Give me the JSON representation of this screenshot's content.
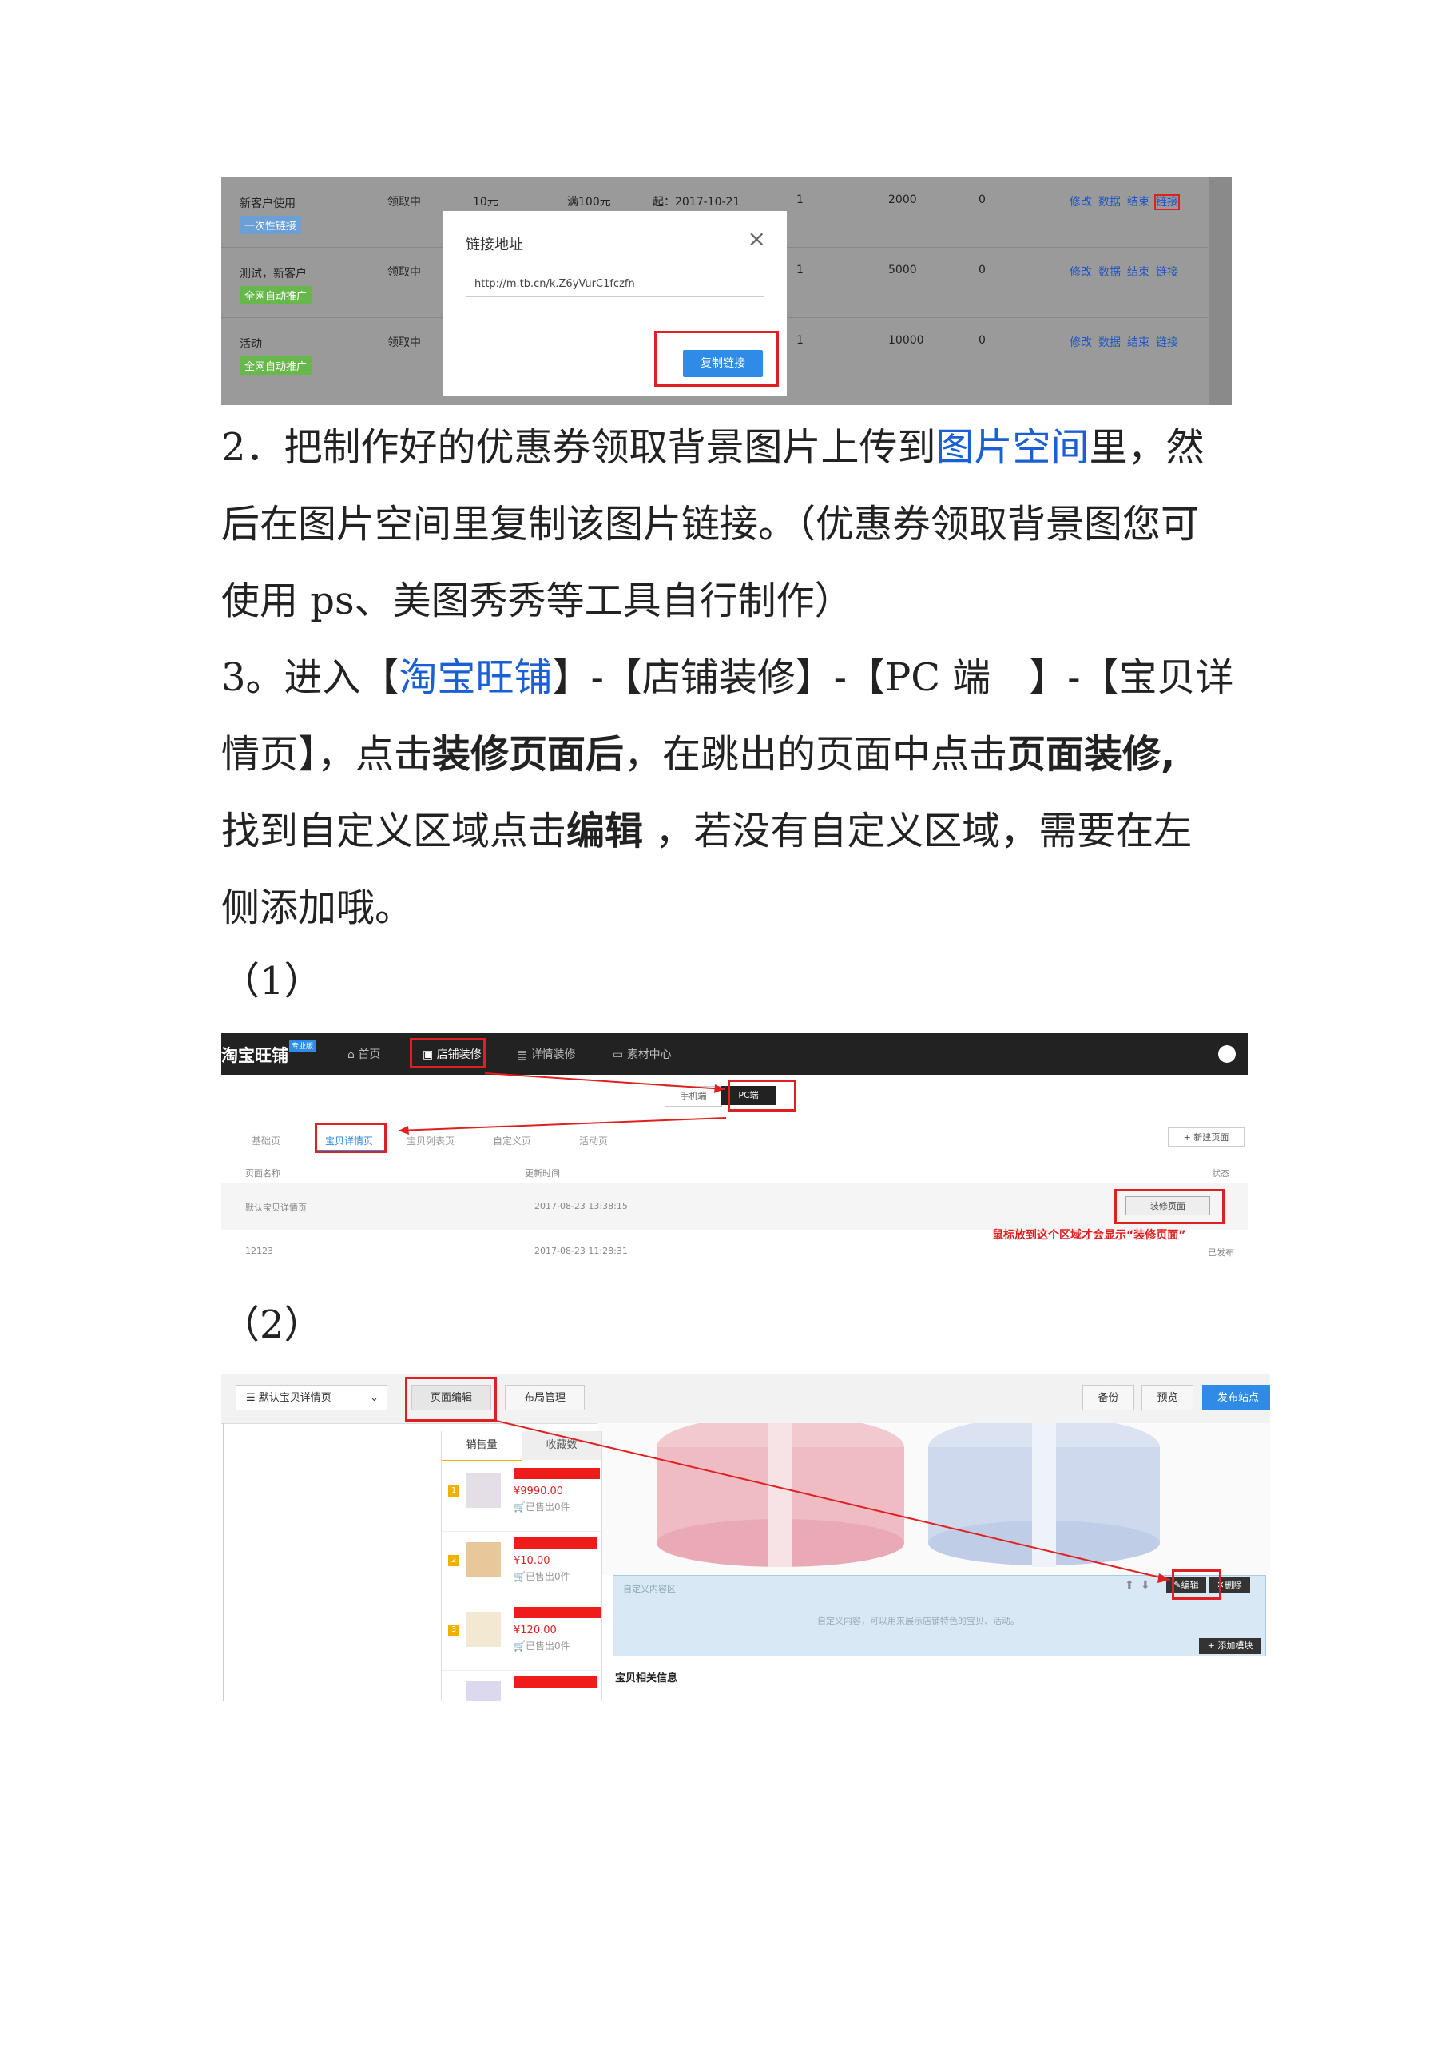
{
  "screenshot1": {
    "rows": [
      {
        "name": "新客户使用",
        "tag": "一次性链接",
        "tag_color": "#6b9fd6",
        "status": "领取中",
        "amount": "10元",
        "condition": "满100元",
        "date": "起：2017-10-21",
        "limit": "1",
        "total": "2000",
        "used": "0"
      },
      {
        "name": "测试，新客户",
        "tag": "全网自动推广",
        "tag_color": "#67b84a",
        "status": "领取中",
        "limit": "1",
        "total": "5000",
        "used": "0"
      },
      {
        "name": "活动",
        "tag": "全网自动推广",
        "tag_color": "#67b84a",
        "status": "领取中",
        "limit": "1",
        "total": "10000",
        "used": "0"
      }
    ],
    "actions": [
      "修改",
      "数据",
      "结束",
      "链接"
    ],
    "dialog": {
      "title": "链接地址",
      "close": "×",
      "url": "http://m.tb.cn/k.Z6yVurC1fczfn",
      "button": "复制链接"
    }
  },
  "paragraphs": {
    "p2_a": "2．把制作好的优惠券领取背景图片上传到",
    "p2_link": "图片空间",
    "p2_b": "里，然",
    "p2_line2": "后在图片空间里复制该图片链接。（优惠券领取背景图您可",
    "p2_line3": "使用 ps、美图秀秀等工具自行制作）",
    "p3_a": "3。进入【",
    "p3_link": "淘宝旺铺",
    "p3_b": "】-【店铺装修】-【PC 端　】-【宝贝详",
    "p3_line2a": "情页】，点击",
    "p3_line2b": "装修页面后",
    "p3_line2c": "，在跳出的页面中点击",
    "p3_line2d": "页面装修,",
    "p3_line3a": "找到自定义区域点击",
    "p3_line3b": "编辑",
    "p3_line3c": " ，若没有自定义区域，需要在左",
    "p3_line4": "侧添加哦。",
    "step1": "（1）",
    "step2": "（2）"
  },
  "screenshot2": {
    "logo": "淘宝旺铺",
    "badge": "专业版",
    "nav": [
      "首页",
      "店铺装修",
      "详情装修",
      "素材中心"
    ],
    "device_tabs": [
      "手机端",
      "PC端"
    ],
    "page_tabs": [
      "基础页",
      "宝贝详情页",
      "宝贝列表页",
      "自定义页",
      "活动页"
    ],
    "new_page": "+ 新建页面",
    "col_headers": [
      "页面名称",
      "更新时间",
      "状态"
    ],
    "rows": [
      {
        "name": "默认宝贝详情页",
        "time": "2017-08-23 13:38:15",
        "status": ""
      },
      {
        "name": "12123",
        "time": "2017-08-23 11:28:31",
        "status": "已发布"
      }
    ],
    "decorate_button": "装修页面",
    "note": "鼠标放到这个区域才会显示“装修页面”"
  },
  "screenshot3": {
    "page_select": "默认宝贝详情页",
    "tabs": [
      "页面编辑",
      "布局管理"
    ],
    "right_buttons": [
      "备份",
      "预览",
      "发布站点"
    ],
    "ranking_tabs": [
      "销售量",
      "收藏数"
    ],
    "items": [
      {
        "rank": "1",
        "price": "¥9990.00",
        "sold": "已售出0件"
      },
      {
        "rank": "2",
        "price": "¥10.00",
        "sold": "已售出0件"
      },
      {
        "rank": "3",
        "price": "¥120.00",
        "sold": "已售出0件"
      }
    ],
    "custom_area_label": "自定义内容区",
    "custom_area_text": "自定义内容，可以用来展示店铺特色的宝贝、活动。",
    "edit_button": "编辑",
    "delete_button": "删除",
    "add_module": "+ 添加模块",
    "related_info": "宝贝相关信息"
  }
}
